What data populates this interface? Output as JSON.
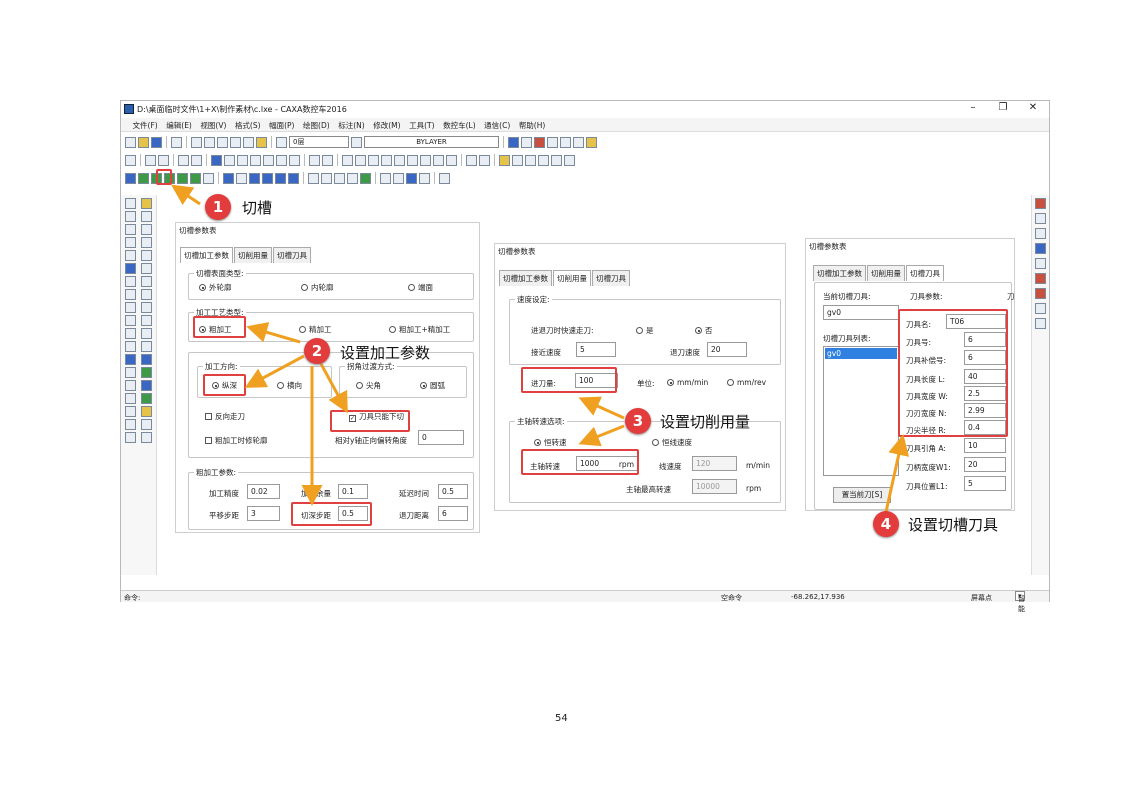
{
  "window": {
    "title": "D:\\桌面临时文件\\1+X\\制作素材\\c.lxe - CAXA数控车2016",
    "min": "–",
    "max": "❐",
    "close": "✕"
  },
  "menu": [
    "文件(F)",
    "编辑(E)",
    "视图(V)",
    "格式(S)",
    "幅面(P)",
    "绘图(D)",
    "标注(N)",
    "修改(M)",
    "工具(T)",
    "数控车(L)",
    "通信(C)",
    "帮助(H)"
  ],
  "toolbar": {
    "layer": "0层",
    "linetype": "BYLAYER"
  },
  "status": {
    "cmd_label": "命令:",
    "cmd_state": "空命令",
    "coords": "-68.262,17.936",
    "snap": "屏幕点",
    "mode": "智能"
  },
  "page_number": "54",
  "annotations": [
    {
      "num": "1",
      "text": "切槽"
    },
    {
      "num": "2",
      "text": "设置加工参数"
    },
    {
      "num": "3",
      "text": "设置切削用量"
    },
    {
      "num": "4",
      "text": "设置切槽刀具"
    }
  ],
  "dialog_title": "切槽参数表",
  "tabs": [
    "切槽加工参数",
    "切削用量",
    "切槽刀具"
  ],
  "p1": {
    "g_surface": "切槽表面类型:",
    "surface_opts": [
      "外轮廓",
      "内轮廓",
      "端面"
    ],
    "g_process": "加工工艺类型:",
    "process_opts": [
      "粗加工",
      "精加工",
      "粗加工+精加工"
    ],
    "g_dir": "加工方向:",
    "dir_opts": [
      "纵深",
      "横向"
    ],
    "g_corner": "拐角过渡方式:",
    "corner_opts": [
      "尖角",
      "圆弧"
    ],
    "reverse": "反向走刀",
    "tool_down": "刀具只能下切",
    "rough_finish": "粗加工时修轮廓",
    "angle_label": "相对y轴正向偏转角度",
    "angle_val": "0",
    "g_rough": "粗加工参数:",
    "precision_label": "加工精度",
    "precision_val": "0.02",
    "allow_label": "加工余量",
    "allow_val": "0.1",
    "delay_label": "延迟时间",
    "delay_val": "0.5",
    "pan_label": "平移步距",
    "pan_val": "3",
    "depth_label": "切深步距",
    "depth_val": "0.5",
    "retract_label": "退刀距离",
    "retract_val": "6"
  },
  "p2": {
    "g_speed": "速度设定:",
    "rapid_label": "进退刀时快速走刀:",
    "yes": "是",
    "no": "否",
    "approach_label": "接近速度",
    "approach_val": "5",
    "retract_label": "退刀速度",
    "retract_val": "20",
    "feed_label": "进刀量:",
    "feed_val": "100",
    "unit_label": "单位:",
    "unit1": "mm/min",
    "unit2": "mm/rev",
    "g_spindle": "主轴转速选项:",
    "const_rpm": "恒转速",
    "const_surface": "恒线速度",
    "spindle_label": "主轴转速",
    "spindle_val": "1000",
    "rpm": "rpm",
    "line_label": "线速度",
    "line_val": "120",
    "line_unit": "m/min",
    "max_label": "主轴最高转速",
    "max_val": "10000",
    "max_unit": "rpm"
  },
  "p3": {
    "current_label": "当前切槽刀具:",
    "current_val": "gv0",
    "list_label": "切槽刀具列表:",
    "list_item": "gv0",
    "params_label": "刀具参数:",
    "params_extra": "刀",
    "set_btn": "置当前刀[S]",
    "rows": [
      {
        "label": "刀具名:",
        "val": "T06"
      },
      {
        "label": "刀具号:",
        "val": "6"
      },
      {
        "label": "刀具补偿号:",
        "val": "6"
      },
      {
        "label": "刀具长度 L:",
        "val": "40"
      },
      {
        "label": "刀具宽度 W:",
        "val": "2.5"
      },
      {
        "label": "刀刃宽度 N:",
        "val": "2.99"
      },
      {
        "label": "刀尖半径 R:",
        "val": "0.4"
      },
      {
        "label": "刀具引角 A:",
        "val": "10"
      },
      {
        "label": "刀柄宽度W1:",
        "val": "20"
      },
      {
        "label": "刀具位置L1:",
        "val": "5"
      }
    ]
  }
}
